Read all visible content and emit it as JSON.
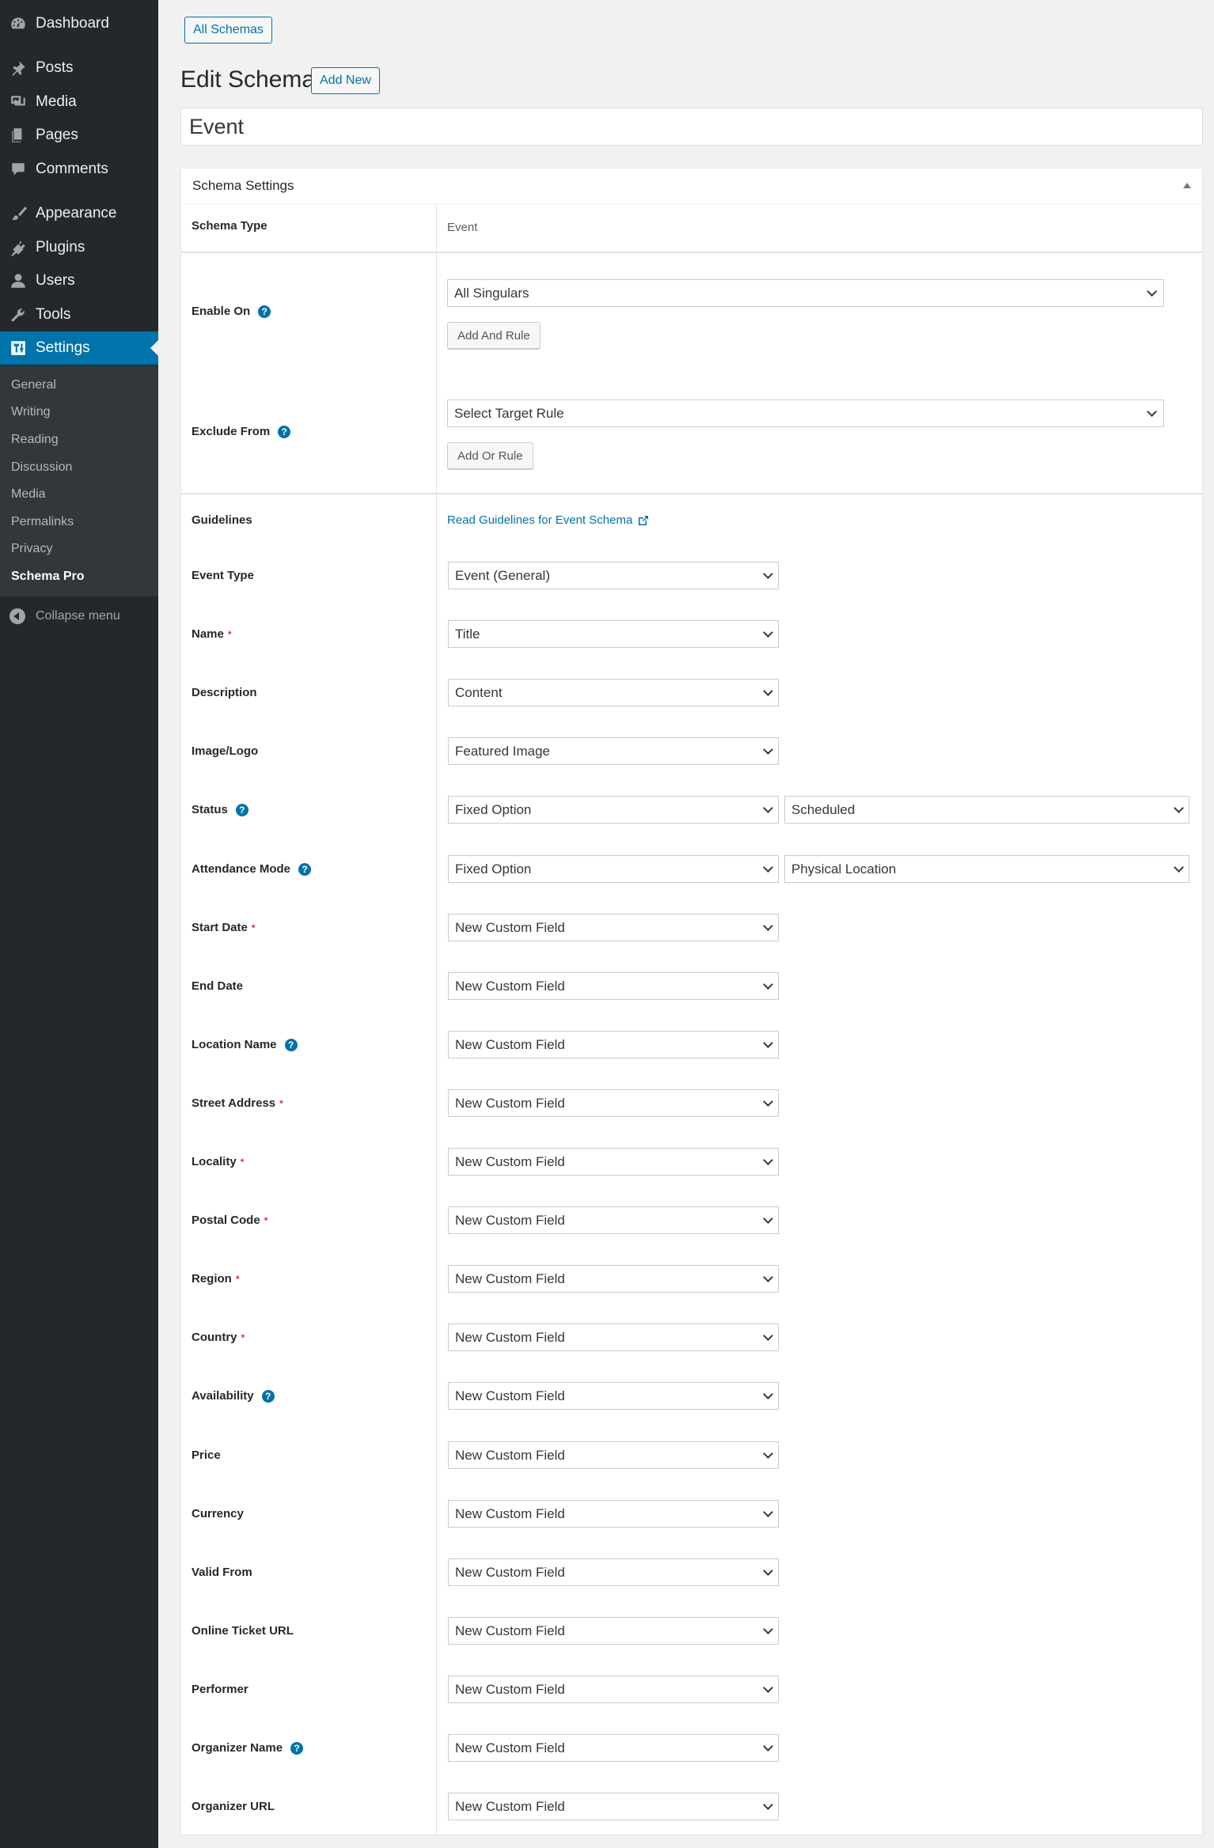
{
  "sidebar": {
    "items": [
      {
        "label": "Dashboard",
        "icon": "dashboard-icon"
      },
      {
        "label": "Posts",
        "icon": "pushpin-icon"
      },
      {
        "label": "Media",
        "icon": "media-icon"
      },
      {
        "label": "Pages",
        "icon": "pages-icon"
      },
      {
        "label": "Comments",
        "icon": "comment-icon"
      },
      {
        "label": "Appearance",
        "icon": "brush-icon"
      },
      {
        "label": "Plugins",
        "icon": "plugin-icon"
      },
      {
        "label": "Users",
        "icon": "user-icon"
      },
      {
        "label": "Tools",
        "icon": "wrench-icon"
      },
      {
        "label": "Settings",
        "icon": "settings-icon"
      }
    ],
    "submenu": [
      "General",
      "Writing",
      "Reading",
      "Discussion",
      "Media",
      "Permalinks",
      "Privacy",
      "Schema Pro"
    ],
    "collapse_label": "Collapse menu"
  },
  "header": {
    "all_schemas": "All Schemas",
    "title": "Edit Schema",
    "add_new": "Add New",
    "post_title": "Event"
  },
  "box": {
    "title": "Schema Settings",
    "schema_type_label": "Schema Type",
    "schema_type_value": "Event",
    "enable_on_label": "Enable On",
    "enable_on_value": "All Singulars",
    "add_and_rule": "Add And Rule",
    "exclude_from_label": "Exclude From",
    "exclude_from_value": "Select Target Rule",
    "add_or_rule": "Add Or Rule",
    "guidelines_label": "Guidelines",
    "guidelines_link": "Read Guidelines for Event Schema"
  },
  "fields": [
    {
      "label": "Event Type",
      "value": "Event (General)",
      "required": false,
      "help": false
    },
    {
      "label": "Name",
      "value": "Title",
      "required": true,
      "help": false
    },
    {
      "label": "Description",
      "value": "Content",
      "required": false,
      "help": false
    },
    {
      "label": "Image/Logo",
      "value": "Featured Image",
      "required": false,
      "help": false
    },
    {
      "label": "Status",
      "value": "Fixed Option",
      "value2": "Scheduled",
      "required": false,
      "help": true
    },
    {
      "label": "Attendance Mode",
      "value": "Fixed Option",
      "value2": "Physical Location",
      "required": false,
      "help": true
    },
    {
      "label": "Start Date",
      "value": "New Custom Field",
      "required": true,
      "help": false
    },
    {
      "label": "End Date",
      "value": "New Custom Field",
      "required": false,
      "help": false
    },
    {
      "label": "Location Name",
      "value": "New Custom Field",
      "required": false,
      "help": true
    },
    {
      "label": "Street Address",
      "value": "New Custom Field",
      "required": true,
      "help": false
    },
    {
      "label": "Locality",
      "value": "New Custom Field",
      "required": true,
      "help": false
    },
    {
      "label": "Postal Code",
      "value": "New Custom Field",
      "required": true,
      "help": false
    },
    {
      "label": "Region",
      "value": "New Custom Field",
      "required": true,
      "help": false
    },
    {
      "label": "Country",
      "value": "New Custom Field",
      "required": true,
      "help": false
    },
    {
      "label": "Availability",
      "value": "New Custom Field",
      "required": false,
      "help": true
    },
    {
      "label": "Price",
      "value": "New Custom Field",
      "required": false,
      "help": false
    },
    {
      "label": "Currency",
      "value": "New Custom Field",
      "required": false,
      "help": false
    },
    {
      "label": "Valid From",
      "value": "New Custom Field",
      "required": false,
      "help": false
    },
    {
      "label": "Online Ticket URL",
      "value": "New Custom Field",
      "required": false,
      "help": false
    },
    {
      "label": "Performer",
      "value": "New Custom Field",
      "required": false,
      "help": false
    },
    {
      "label": "Organizer Name",
      "value": "New Custom Field",
      "required": false,
      "help": true
    },
    {
      "label": "Organizer URL",
      "value": "New Custom Field",
      "required": false,
      "help": false
    }
  ],
  "symbols": {
    "required": "*",
    "help": "?"
  },
  "colors": {
    "accent": "#0073aa",
    "sidebar": "#23282d",
    "required": "#dc3232"
  }
}
